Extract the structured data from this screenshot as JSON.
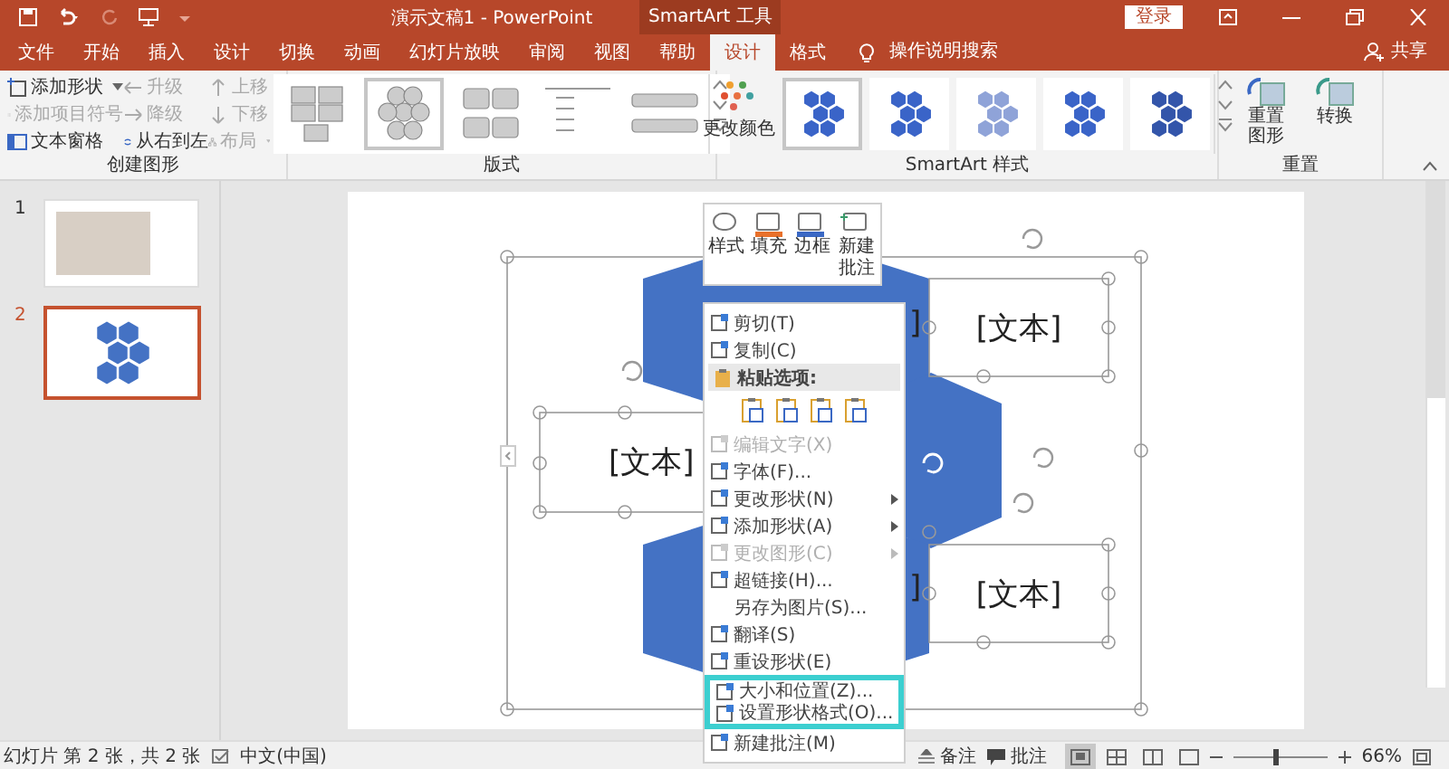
{
  "window": {
    "title": "演示文稿1 - PowerPoint",
    "context_group": "SmartArt 工具",
    "sign_in": "登录"
  },
  "tabs": [
    {
      "label": "文件",
      "selected": false
    },
    {
      "label": "开始",
      "selected": false
    },
    {
      "label": "插入",
      "selected": false
    },
    {
      "label": "设计",
      "selected": false
    },
    {
      "label": "切换",
      "selected": false
    },
    {
      "label": "动画",
      "selected": false
    },
    {
      "label": "幻灯片放映",
      "selected": false
    },
    {
      "label": "审阅",
      "selected": false
    },
    {
      "label": "视图",
      "selected": false
    },
    {
      "label": "帮助",
      "selected": false
    },
    {
      "label": "设计",
      "selected": true
    },
    {
      "label": "格式",
      "selected": false
    }
  ],
  "tell_me": "操作说明搜索",
  "share": "共享",
  "create_graphic": {
    "label": "创建图形",
    "items": [
      {
        "label": "添加形状",
        "disabled": false,
        "dropdown": true
      },
      {
        "label": "升级",
        "disabled": true,
        "dropdown": false
      },
      {
        "label": "上移",
        "disabled": true,
        "dropdown": false
      },
      {
        "label": "添加项目符号",
        "disabled": true,
        "dropdown": false
      },
      {
        "label": "降级",
        "disabled": true,
        "dropdown": false
      },
      {
        "label": "下移",
        "disabled": true,
        "dropdown": false
      },
      {
        "label": "文本窗格",
        "disabled": false,
        "dropdown": false
      },
      {
        "label": "从右到左",
        "disabled": false,
        "dropdown": false
      },
      {
        "label": "布局",
        "disabled": true,
        "dropdown": true
      }
    ]
  },
  "layouts": {
    "label": "版式",
    "thumbnails": [
      {
        "selected": false
      },
      {
        "selected": true
      },
      {
        "selected": false
      },
      {
        "selected": false
      },
      {
        "selected": false
      }
    ]
  },
  "smartart_styles": {
    "change_colors": "更改颜色",
    "label": "SmartArt 样式",
    "thumbnails": [
      {
        "selected": true
      },
      {
        "selected": false
      },
      {
        "selected": false
      },
      {
        "selected": false
      },
      {
        "selected": false
      }
    ]
  },
  "reset": {
    "label": "重置",
    "buttons": [
      {
        "label": "重置图形"
      },
      {
        "label": "转换"
      }
    ]
  },
  "slides": [
    {
      "number": "1",
      "selected": false,
      "kind": "photo"
    },
    {
      "number": "2",
      "selected": true,
      "kind": "hexagons"
    }
  ],
  "canvas": {
    "text_boxes": [
      "[文本]",
      "[文本]",
      "[文本]"
    ],
    "hexagon_labels": [
      "]",
      "]"
    ]
  },
  "mini_toolbar": [
    {
      "label": "样式"
    },
    {
      "label": "填充"
    },
    {
      "label": "边框"
    },
    {
      "label": "新建批注"
    }
  ],
  "context_menu": [
    {
      "kind": "item",
      "label": "剪切(T)",
      "disabled": false,
      "submenu": false,
      "highlighted": false
    },
    {
      "kind": "item",
      "label": "复制(C)",
      "disabled": false,
      "submenu": false,
      "highlighted": false
    },
    {
      "kind": "header",
      "label": "粘贴选项:"
    },
    {
      "kind": "paste_options"
    },
    {
      "kind": "item",
      "label": "编辑文字(X)",
      "disabled": true,
      "submenu": false,
      "highlighted": false
    },
    {
      "kind": "item",
      "label": "字体(F)...",
      "disabled": false,
      "submenu": false,
      "highlighted": false
    },
    {
      "kind": "item",
      "label": "更改形状(N)",
      "disabled": false,
      "submenu": true,
      "highlighted": false
    },
    {
      "kind": "item",
      "label": "添加形状(A)",
      "disabled": false,
      "submenu": true,
      "highlighted": false
    },
    {
      "kind": "item",
      "label": "更改图形(C)",
      "disabled": true,
      "submenu": true,
      "highlighted": false
    },
    {
      "kind": "item",
      "label": "超链接(H)...",
      "disabled": false,
      "submenu": false,
      "highlighted": false
    },
    {
      "kind": "item",
      "label": "另存为图片(S)...",
      "disabled": false,
      "submenu": false,
      "highlighted": false
    },
    {
      "kind": "item",
      "label": "翻译(S)",
      "disabled": false,
      "submenu": false,
      "highlighted": false
    },
    {
      "kind": "item",
      "label": "重设形状(E)",
      "disabled": false,
      "submenu": false,
      "highlighted": false
    },
    {
      "kind": "item",
      "label": "大小和位置(Z)...",
      "disabled": false,
      "submenu": false,
      "highlighted": true
    },
    {
      "kind": "item",
      "label": "设置形状格式(O)...",
      "disabled": false,
      "submenu": false,
      "highlighted": true
    },
    {
      "kind": "item",
      "label": "新建批注(M)",
      "disabled": false,
      "submenu": false,
      "highlighted": false
    }
  ],
  "status_bar": {
    "slide_info": "幻灯片 第 2 张，共 2 张",
    "language": "中文(中国)",
    "notes": "备注",
    "comments": "批注",
    "views": [
      {
        "selected": true
      },
      {
        "selected": false
      },
      {
        "selected": false
      },
      {
        "selected": false
      }
    ],
    "zoom": {
      "level": 0.42
    },
    "zoom_percent": "66%"
  }
}
